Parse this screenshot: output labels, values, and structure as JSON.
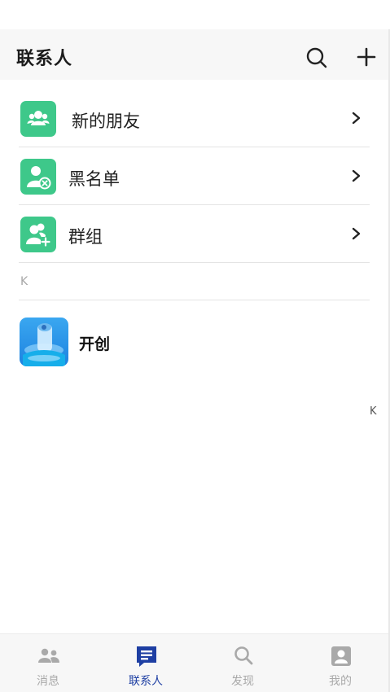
{
  "header": {
    "title": "联系人"
  },
  "functions": [
    {
      "label": "新的朋友",
      "icon": "new-friends-icon"
    },
    {
      "label": "黑名单",
      "icon": "blacklist-icon"
    },
    {
      "label": "群组",
      "icon": "group-add-icon"
    }
  ],
  "section": {
    "letter": "K"
  },
  "contacts": [
    {
      "name": "开创"
    }
  ],
  "index_bar": {
    "letters": [
      "K"
    ]
  },
  "tabbar": {
    "tabs": [
      {
        "label": "消息",
        "icon": "people-icon",
        "active": false
      },
      {
        "label": "联系人",
        "icon": "contacts-card-icon",
        "active": true
      },
      {
        "label": "发现",
        "icon": "search-icon",
        "active": false
      },
      {
        "label": "我的",
        "icon": "profile-icon",
        "active": false
      }
    ]
  },
  "colors": {
    "accent_green": "#3ec88a",
    "active_tab": "#1e3fa3",
    "inactive_tab": "#a9a9a9"
  }
}
